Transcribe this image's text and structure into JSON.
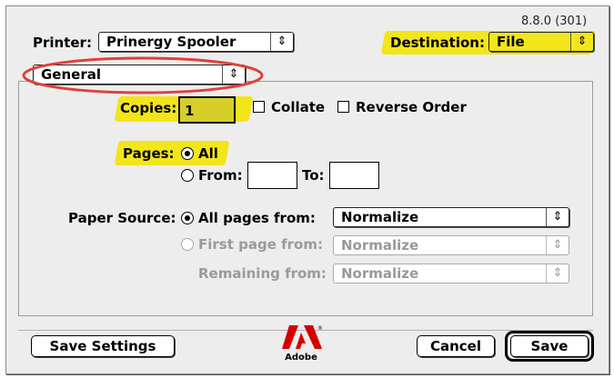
{
  "version": "8.8.0 (301)",
  "printer": {
    "label": "Printer:",
    "value": "Prinergy Spooler"
  },
  "destination": {
    "label": "Destination:",
    "value": "File"
  },
  "section_popup": {
    "value": "General"
  },
  "copies": {
    "label": "Copies:",
    "value": "1"
  },
  "collate": {
    "label": "Collate",
    "checked": false
  },
  "reverse_order": {
    "label": "Reverse Order",
    "checked": false
  },
  "pages": {
    "label": "Pages:",
    "all_label": "All",
    "from_label": "From:",
    "to_label": "To:",
    "from_value": "",
    "to_value": "",
    "selected": "All"
  },
  "paper_source": {
    "label": "Paper Source:",
    "all_pages_label": "All pages from:",
    "all_pages_value": "Normalize",
    "first_page_label": "First page from:",
    "first_page_value": "Normalize",
    "remaining_label": "Remaining from:",
    "remaining_value": "Normalize",
    "selected": "All pages from:"
  },
  "buttons": {
    "save_settings": "Save Settings",
    "cancel": "Cancel",
    "save": "Save"
  },
  "logo": {
    "text": "Adobe"
  },
  "colors": {
    "highlight": "#f2e51a",
    "annotation_circle": "#e0403a",
    "dialog_bg": "#ededed"
  },
  "icons": {
    "popup_arrows": "up-down-arrows-icon",
    "logo": "adobe-logo-icon"
  }
}
